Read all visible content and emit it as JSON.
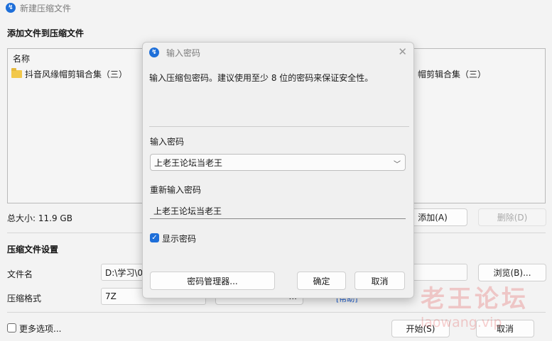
{
  "window": {
    "title": "新建压缩文件"
  },
  "add_section": {
    "title": "添加文件到压缩文件",
    "column_name": "名称",
    "file_name": "抖音风缘帽剪辑合集（三）",
    "file_name_right": "帽剪辑合集（三）",
    "total_size": "总大小: 11.9 GB",
    "add_button": "添加(A)",
    "delete_button": "删除(D)"
  },
  "settings_section": {
    "title": "压缩文件设置",
    "filename_label": "文件名",
    "filename_value": "D:\\学习\\0",
    "browse_button": "浏览(B)...",
    "format_label": "压缩格式",
    "format_value": "7Z",
    "settings_button_partial": "...",
    "link_partial": "[帮助]",
    "more_options": "更多选项...",
    "start_button": "开始(S)",
    "cancel_button": "取消"
  },
  "dialog": {
    "title": "输入密码",
    "description": "输入压缩包密码。建议使用至少 8 位的密码来保证安全性。",
    "password_label": "输入密码",
    "password_value": "上老王论坛当老王",
    "reenter_label": "重新输入密码",
    "reenter_value": "上老王论坛当老王",
    "show_password_label": "显示密码",
    "show_password_checked": true,
    "manager_button": "密码管理器...",
    "ok_button": "确定",
    "cancel_button": "取消"
  },
  "watermark": {
    "text": "老王论坛",
    "sub": "laowang.vip"
  },
  "colors": {
    "accent": "#1e6fd9",
    "watermark": "#e12828"
  }
}
